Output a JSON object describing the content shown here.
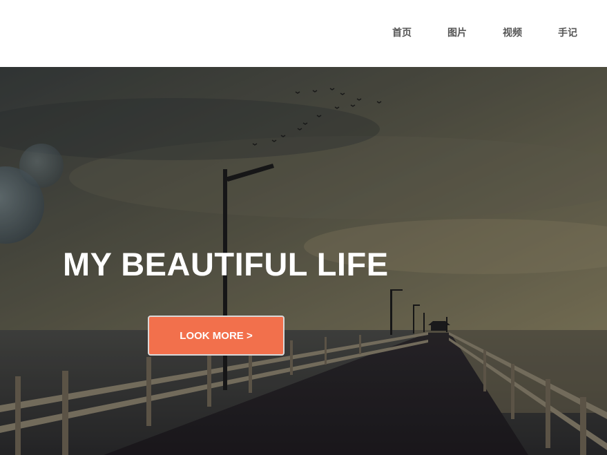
{
  "nav": {
    "items": [
      {
        "label": "首页"
      },
      {
        "label": "图片"
      },
      {
        "label": "视频"
      },
      {
        "label": "手记"
      }
    ]
  },
  "hero": {
    "title": "MY BEAUTIFUL LIFE",
    "button_label": "LOOK MORE >",
    "background": "pier-at-dusk",
    "accent_color": "#f2704c"
  }
}
